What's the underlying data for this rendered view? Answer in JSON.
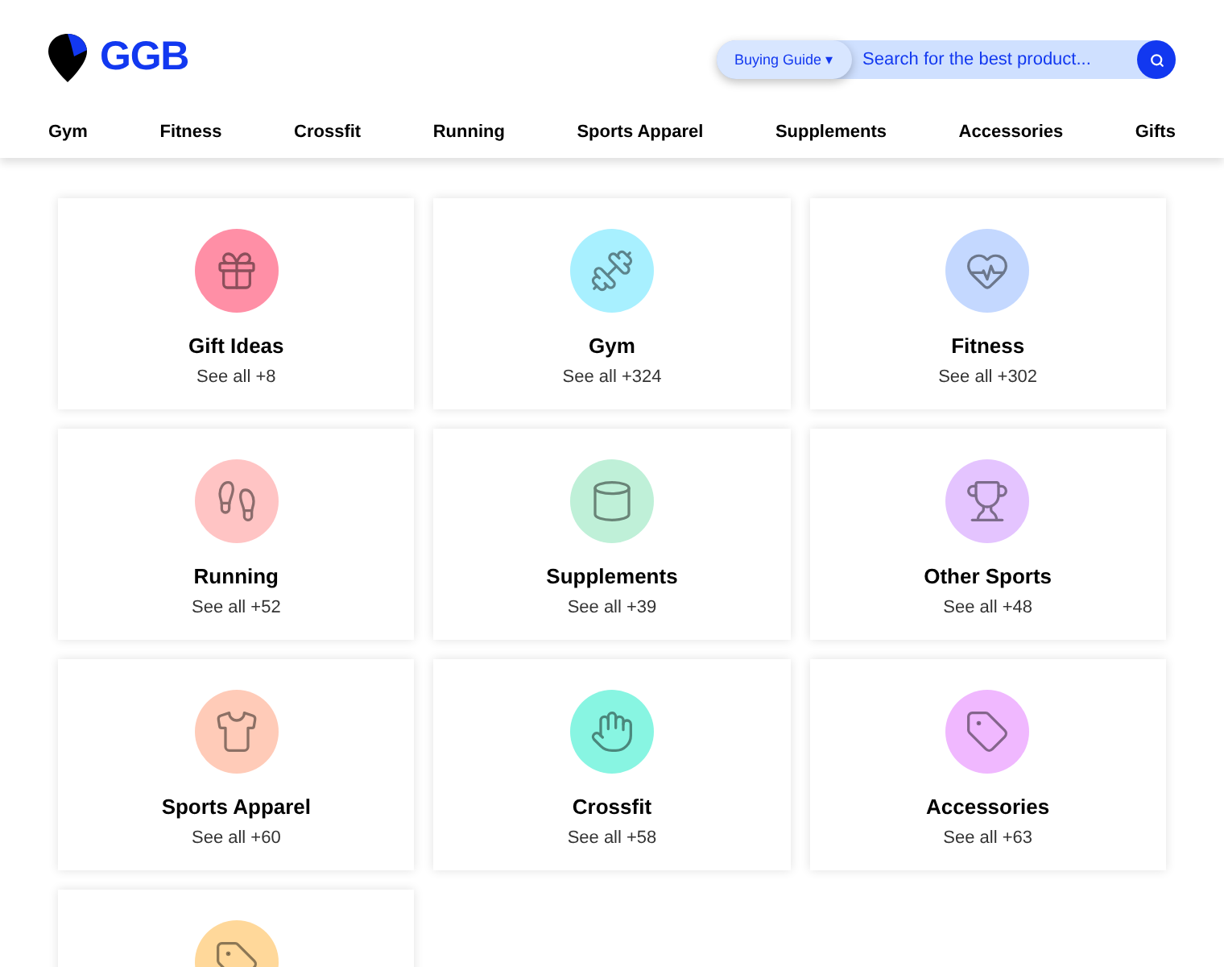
{
  "header": {
    "logo": "GGB",
    "buying_guide": "Buying Guide ▾",
    "search": {
      "placeholder": "Search for the best product..."
    }
  },
  "nav": [
    "Gym",
    "Fitness",
    "Crossfit",
    "Running",
    "Sports Apparel",
    "Supplements",
    "Accessories",
    "Gifts"
  ],
  "categories": [
    {
      "title": "Gift Ideas",
      "link": "See all +8",
      "color": "#ff8fa6"
    },
    {
      "title": "Gym",
      "link": "See all +324",
      "color": "#a8f0ff"
    },
    {
      "title": "Fitness",
      "link": "See all +302",
      "color": "#c4d8ff"
    },
    {
      "title": "Running",
      "link": "See all +52",
      "color": "#ffc4c4"
    },
    {
      "title": "Supplements",
      "link": "See all +39",
      "color": "#bff0d8"
    },
    {
      "title": "Other Sports",
      "link": "See all +48",
      "color": "#e4c4ff"
    },
    {
      "title": "Sports Apparel",
      "link": "See all +60",
      "color": "#ffcbb8"
    },
    {
      "title": "Crossfit",
      "link": "See all +58",
      "color": "#88f5e2"
    },
    {
      "title": "Accessories",
      "link": "See all +63",
      "color": "#f0b8ff"
    },
    {
      "color": "#ffd89a"
    }
  ]
}
